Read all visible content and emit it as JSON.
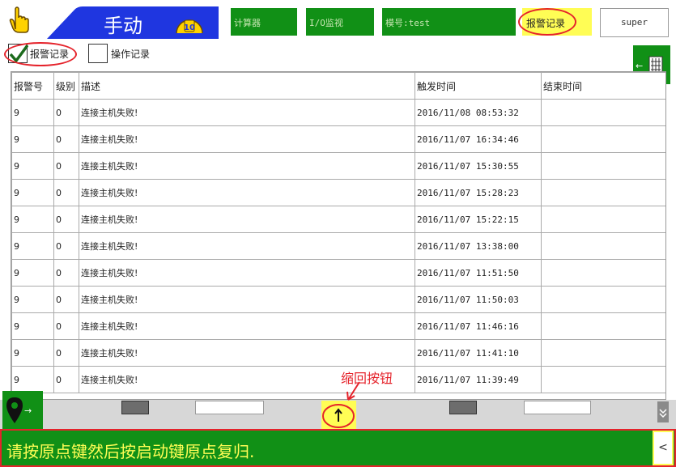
{
  "header": {
    "mode_label": "手动",
    "dial_value": "10",
    "buttons": [
      "计算器",
      "I/O监视",
      "模号:test"
    ],
    "alarm_button": "报警记录",
    "user": "super"
  },
  "options": {
    "alarm_records_label": "报警记录",
    "alarm_records_checked": true,
    "operation_records_label": "操作记录",
    "operation_records_checked": false
  },
  "table": {
    "columns": [
      "报警号",
      "级别",
      "描述",
      "触发时间",
      "结束时间"
    ],
    "rows": [
      [
        "9",
        "0",
        "连接主机失败!",
        "2016/11/08 08:53:32",
        ""
      ],
      [
        "9",
        "0",
        "连接主机失败!",
        "2016/11/07 16:34:46",
        ""
      ],
      [
        "9",
        "0",
        "连接主机失败!",
        "2016/11/07 15:30:55",
        ""
      ],
      [
        "9",
        "0",
        "连接主机失败!",
        "2016/11/07 15:28:23",
        ""
      ],
      [
        "9",
        "0",
        "连接主机失败!",
        "2016/11/07 15:22:15",
        ""
      ],
      [
        "9",
        "0",
        "连接主机失败!",
        "2016/11/07 13:38:00",
        ""
      ],
      [
        "9",
        "0",
        "连接主机失败!",
        "2016/11/07 11:51:50",
        ""
      ],
      [
        "9",
        "0",
        "连接主机失败!",
        "2016/11/07 11:50:03",
        ""
      ],
      [
        "9",
        "0",
        "连接主机失败!",
        "2016/11/07 11:46:16",
        ""
      ],
      [
        "9",
        "0",
        "连接主机失败!",
        "2016/11/07 11:41:10",
        ""
      ],
      [
        "9",
        "0",
        "连接主机失败!",
        "2016/11/07 11:39:49",
        ""
      ]
    ]
  },
  "annotation": {
    "collapse_label": "缩回按钮"
  },
  "status": {
    "message": "请按原点键然后按启动键原点复归."
  },
  "colors": {
    "panel_green": "#119016",
    "alert_yellow": "#fffd55",
    "mode_blue": "#1f36e0",
    "annotation_red": "#e5232b"
  }
}
